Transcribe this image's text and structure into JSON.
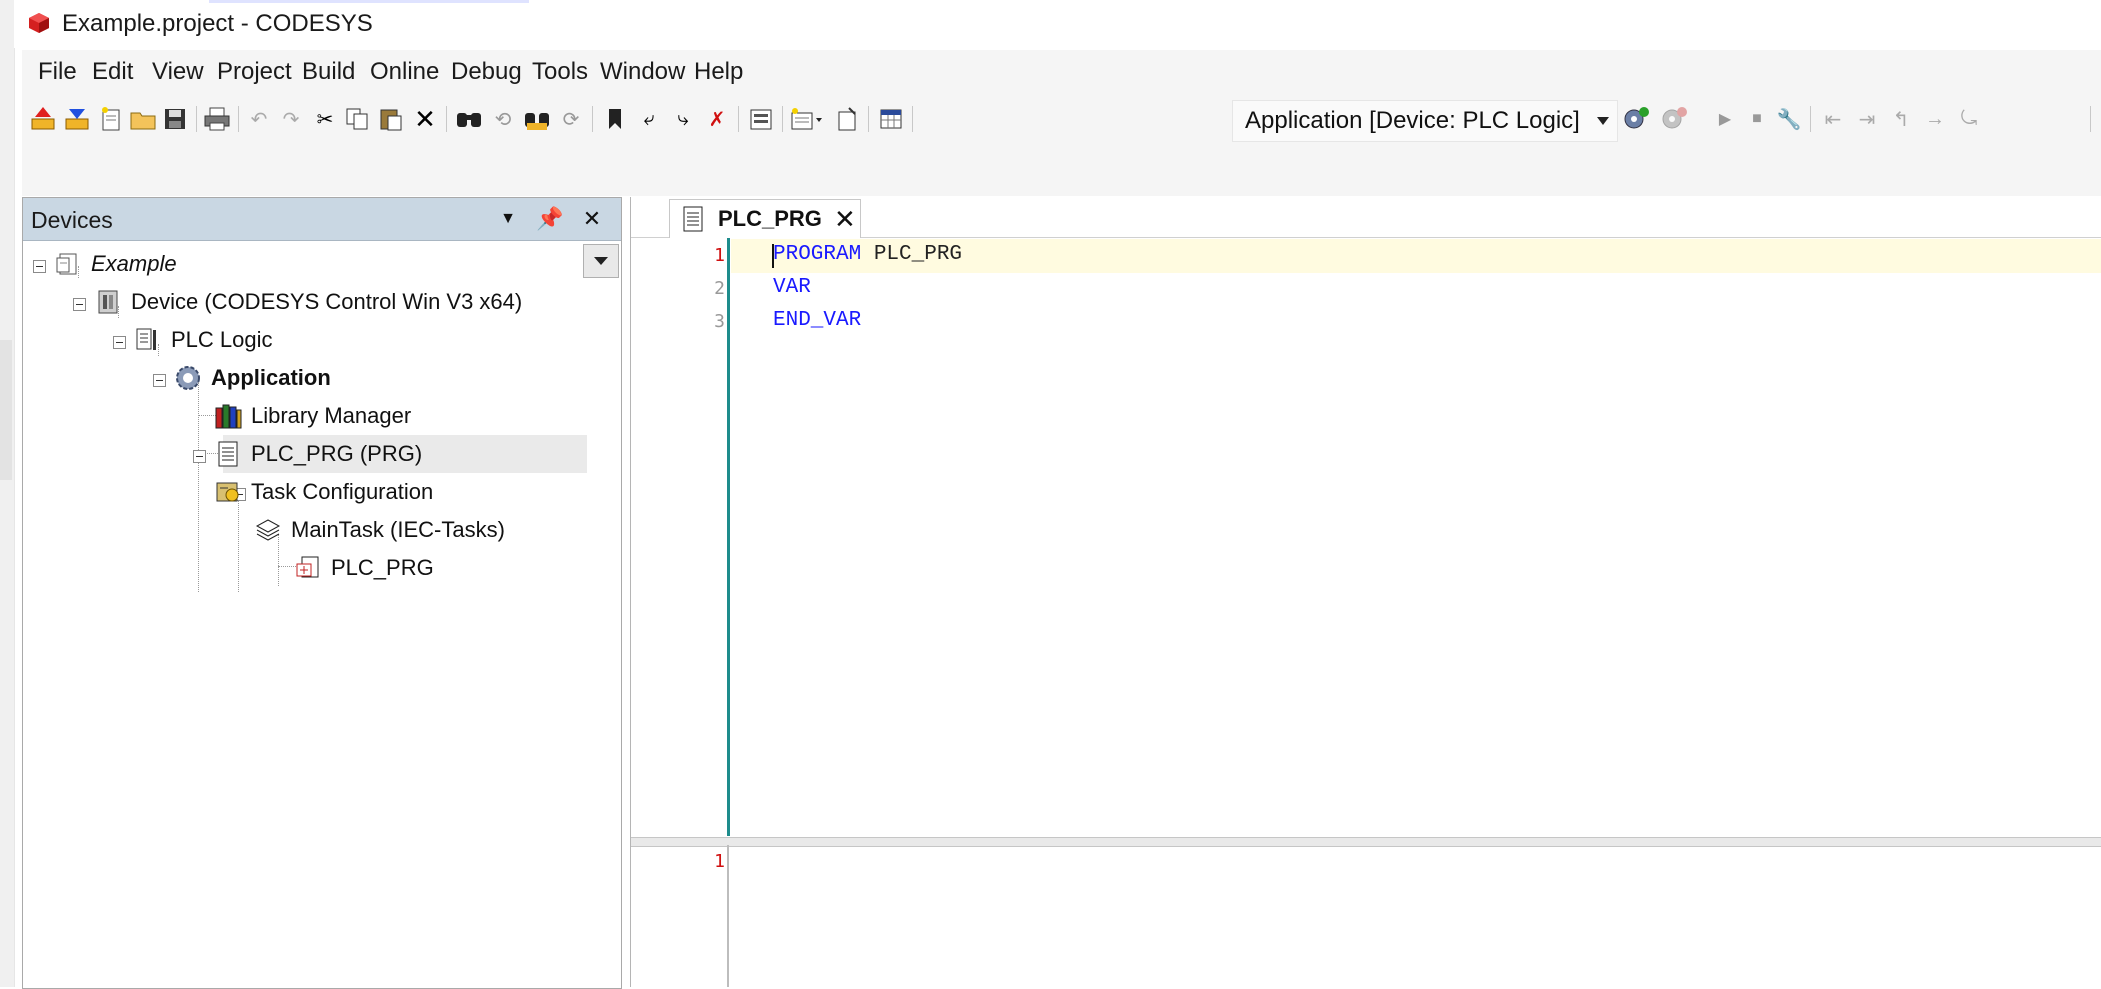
{
  "window": {
    "title": "Example.project - CODESYS"
  },
  "menu": [
    "File",
    "Edit",
    "View",
    "Project",
    "Build",
    "Online",
    "Debug",
    "Tools",
    "Window",
    "Help"
  ],
  "toolbar": {
    "active_application": "Application [Device: PLC Logic]"
  },
  "devices_panel": {
    "title": "Devices",
    "tree": [
      {
        "label": "Example",
        "icon": "project-icon"
      },
      {
        "label": "Device (CODESYS Control Win V3 x64)",
        "icon": "device-icon"
      },
      {
        "label": "PLC Logic",
        "icon": "plc-logic-icon"
      },
      {
        "label": "Application",
        "icon": "application-gear-icon"
      },
      {
        "label": "Library Manager",
        "icon": "library-books-icon"
      },
      {
        "label": "PLC_PRG (PRG)",
        "icon": "pou-document-icon"
      },
      {
        "label": "Task Configuration",
        "icon": "task-config-icon"
      },
      {
        "label": "MainTask (IEC-Tasks)",
        "icon": "task-stack-icon"
      },
      {
        "label": "PLC_PRG",
        "icon": "program-call-icon"
      }
    ]
  },
  "editor": {
    "tab_label": "PLC_PRG",
    "declaration": {
      "line_numbers": [
        "1",
        "2",
        "3"
      ],
      "lines": [
        {
          "keyword": "PROGRAM",
          "rest": " PLC_PRG"
        },
        {
          "keyword": "VAR",
          "rest": ""
        },
        {
          "keyword": "END_VAR",
          "rest": ""
        }
      ]
    },
    "implementation": {
      "line_numbers": [
        "1"
      ]
    }
  },
  "colors": {
    "panel_header": "#c9d7e3",
    "keyword": "#1a1aff",
    "gutter_line": "#1e8c8c",
    "line_number_error": "#d01010"
  }
}
